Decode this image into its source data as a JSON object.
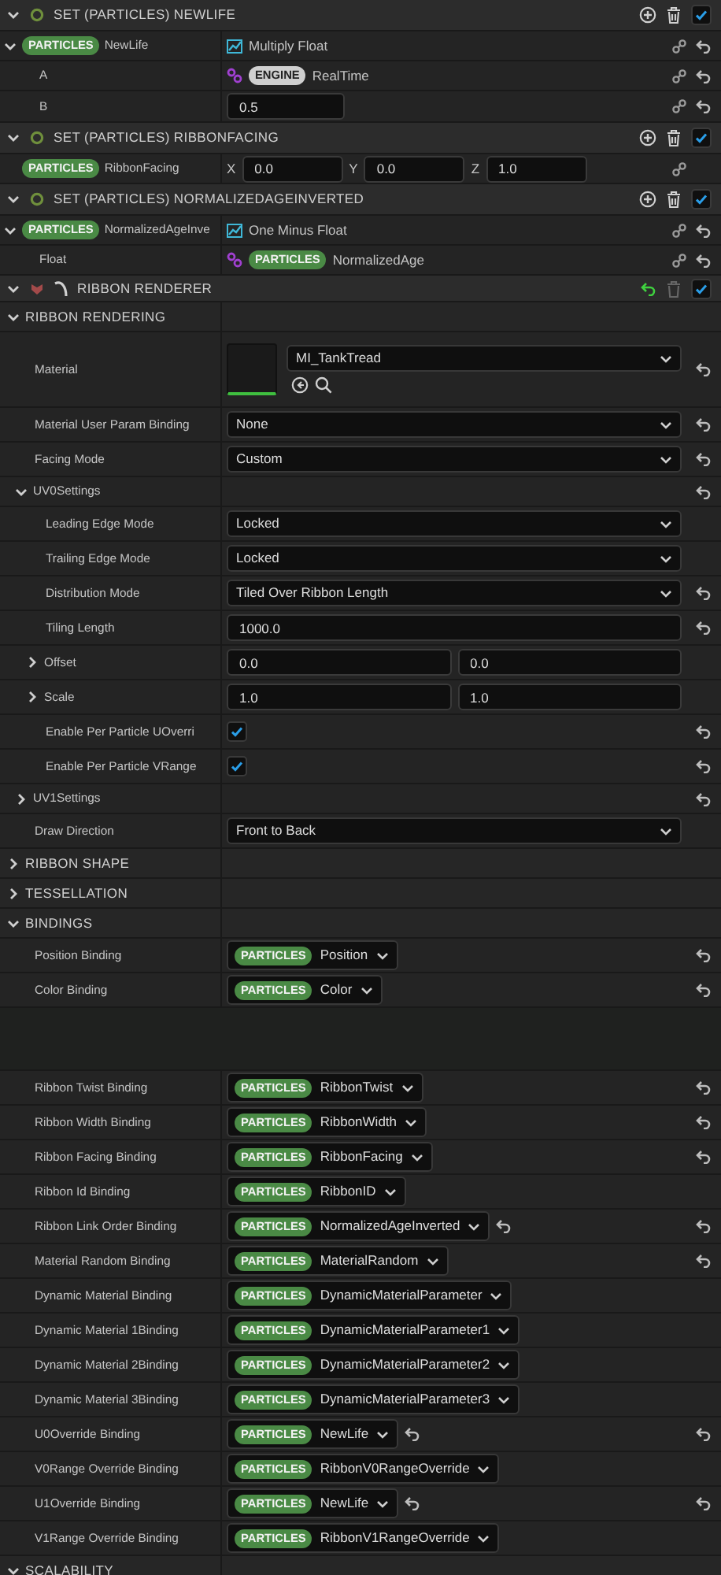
{
  "modules": [
    {
      "title": "SET (PARTICLES) NEWLIFE",
      "expanded": true,
      "enabled": true,
      "params": [
        {
          "kind": "dynamic",
          "namespace": "PARTICLES",
          "name": "NewLife",
          "expanded": true,
          "function": "Multiply Float",
          "reset": true,
          "inputs": [
            {
              "kind": "linked",
              "label": "A",
              "namespace": "ENGINE",
              "value": "RealTime",
              "reset": true
            },
            {
              "kind": "number",
              "label": "B",
              "value": "0.5",
              "reset": true
            }
          ]
        }
      ]
    },
    {
      "title": "SET (PARTICLES) RIBBONFACING",
      "expanded": true,
      "enabled": true,
      "params": [
        {
          "kind": "vector",
          "namespace": "PARTICLES",
          "name": "RibbonFacing",
          "reset": false,
          "components": [
            {
              "axis": "X",
              "value": "0.0"
            },
            {
              "axis": "Y",
              "value": "0.0"
            },
            {
              "axis": "Z",
              "value": "1.0"
            }
          ]
        }
      ]
    },
    {
      "title": "SET (PARTICLES) NORMALIZEDAGEINVERTED",
      "expanded": true,
      "enabled": true,
      "params": [
        {
          "kind": "dynamic",
          "namespace": "PARTICLES",
          "name": "NormalizedAgeInve",
          "expanded": true,
          "function": "One Minus Float",
          "reset": true,
          "inputs": [
            {
              "kind": "linked",
              "label": "Float",
              "namespace": "PARTICLES",
              "value": "NormalizedAge",
              "reset": true
            }
          ]
        }
      ]
    }
  ],
  "renderer": {
    "title": "RIBBON RENDERER",
    "expanded": true,
    "enabled": true,
    "reset": true,
    "categories": [
      {
        "title": "RIBBON RENDERING",
        "expanded": true,
        "rows": [
          {
            "kind": "asset",
            "label": "Material",
            "value": "MI_TankTread",
            "reset": true
          },
          {
            "kind": "dropdown",
            "label": "Material User Param Binding",
            "value": "None",
            "reset": true
          },
          {
            "kind": "dropdown",
            "label": "Facing Mode",
            "value": "Custom",
            "reset": true
          },
          {
            "kind": "group",
            "label": "UV0Settings",
            "expanded": true,
            "reset": true,
            "children": [
              {
                "kind": "dropdown",
                "label": "Leading Edge Mode",
                "value": "Locked",
                "reset": false
              },
              {
                "kind": "dropdown",
                "label": "Trailing Edge Mode",
                "value": "Locked",
                "reset": false
              },
              {
                "kind": "dropdown",
                "label": "Distribution Mode",
                "value": "Tiled Over Ribbon Length",
                "reset": true
              },
              {
                "kind": "number",
                "label": "Tiling Length",
                "value": "1000.0",
                "reset": true
              },
              {
                "kind": "vector2",
                "label": "Offset",
                "expanded": false,
                "values": [
                  "0.0",
                  "0.0"
                ],
                "reset": false
              },
              {
                "kind": "vector2",
                "label": "Scale",
                "expanded": false,
                "values": [
                  "1.0",
                  "1.0"
                ],
                "reset": false
              },
              {
                "kind": "checkbox",
                "label": "Enable Per Particle UOverri",
                "checked": true,
                "reset": true
              },
              {
                "kind": "checkbox",
                "label": "Enable Per Particle VRange",
                "checked": true,
                "reset": true
              }
            ]
          },
          {
            "kind": "group",
            "label": "UV1Settings",
            "expanded": false,
            "reset": true
          },
          {
            "kind": "dropdown",
            "label": "Draw Direction",
            "value": "Front to Back",
            "reset": false
          }
        ]
      },
      {
        "title": "RIBBON SHAPE",
        "expanded": false
      },
      {
        "title": "TESSELLATION",
        "expanded": false
      },
      {
        "title": "BINDINGS",
        "expanded": true,
        "rows": [
          {
            "kind": "binding",
            "label": "Position Binding",
            "namespace": "PARTICLES",
            "value": "Position",
            "inline_reset": false,
            "reset": true
          },
          {
            "kind": "binding",
            "label": "Color Binding",
            "namespace": "PARTICLES",
            "value": "Color",
            "inline_reset": false,
            "reset": true
          },
          {
            "kind": "gap"
          },
          {
            "kind": "binding",
            "label": "Ribbon Twist Binding",
            "namespace": "PARTICLES",
            "value": "RibbonTwist",
            "inline_reset": false,
            "reset": true
          },
          {
            "kind": "binding",
            "label": "Ribbon Width Binding",
            "namespace": "PARTICLES",
            "value": "RibbonWidth",
            "inline_reset": false,
            "reset": true
          },
          {
            "kind": "binding",
            "label": "Ribbon Facing Binding",
            "namespace": "PARTICLES",
            "value": "RibbonFacing",
            "inline_reset": false,
            "reset": true
          },
          {
            "kind": "binding",
            "label": "Ribbon Id Binding",
            "namespace": "PARTICLES",
            "value": "RibbonID",
            "inline_reset": false,
            "reset": false
          },
          {
            "kind": "binding",
            "label": "Ribbon Link Order Binding",
            "namespace": "PARTICLES",
            "value": "NormalizedAgeInverted",
            "inline_reset": true,
            "reset": true
          },
          {
            "kind": "binding",
            "label": "Material Random Binding",
            "namespace": "PARTICLES",
            "value": "MaterialRandom",
            "inline_reset": false,
            "reset": true
          },
          {
            "kind": "binding",
            "label": "Dynamic Material Binding",
            "namespace": "PARTICLES",
            "value": "DynamicMaterialParameter",
            "inline_reset": false,
            "reset": false
          },
          {
            "kind": "binding",
            "label": "Dynamic Material 1Binding",
            "namespace": "PARTICLES",
            "value": "DynamicMaterialParameter1",
            "inline_reset": false,
            "reset": false
          },
          {
            "kind": "binding",
            "label": "Dynamic Material 2Binding",
            "namespace": "PARTICLES",
            "value": "DynamicMaterialParameter2",
            "inline_reset": false,
            "reset": false
          },
          {
            "kind": "binding",
            "label": "Dynamic Material 3Binding",
            "namespace": "PARTICLES",
            "value": "DynamicMaterialParameter3",
            "inline_reset": false,
            "reset": false
          },
          {
            "kind": "binding",
            "label": "U0Override Binding",
            "namespace": "PARTICLES",
            "value": "NewLife",
            "inline_reset": true,
            "reset": true
          },
          {
            "kind": "binding",
            "label": "V0Range Override Binding",
            "namespace": "PARTICLES",
            "value": "RibbonV0RangeOverride",
            "inline_reset": false,
            "reset": false
          },
          {
            "kind": "binding",
            "label": "U1Override Binding",
            "namespace": "PARTICLES",
            "value": "NewLife",
            "inline_reset": true,
            "reset": true
          },
          {
            "kind": "binding",
            "label": "V1Range Override Binding",
            "namespace": "PARTICLES",
            "value": "RibbonV1RangeOverride",
            "inline_reset": false,
            "reset": false
          }
        ]
      },
      {
        "title": "SCALABILITY",
        "expanded": true
      }
    ]
  }
}
